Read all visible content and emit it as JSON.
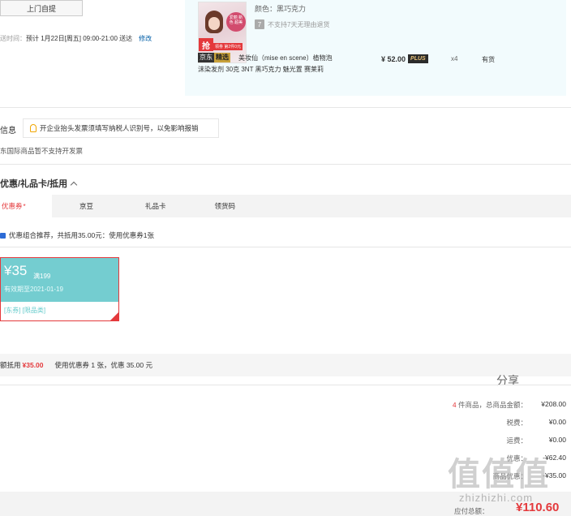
{
  "delivery": {
    "pickup_button": "上门自提",
    "time_label": "送时间：",
    "time_value": "预计 1月22日[周五] 09:00-21:00 送达",
    "modify": "修改"
  },
  "product": {
    "color": "颜色：黑巧克力",
    "no_return": "不支持7天无理由退货",
    "return_icon": "7",
    "tag_jd": "京东",
    "tag_jx": "精选",
    "thumb_grab": "抢",
    "thumb_caption": "领劵 第2件0元",
    "thumb_badge": "爱丽 新色 超美",
    "name_line1": "美妆仙（mise en scene）植物泡",
    "name_line2": "沫染发剂 30克 3NT 黑巧克力 魅光置 赛莱莉",
    "price": "¥ 52.00",
    "plus": "PLUS",
    "qty": "x4",
    "stock": "有货"
  },
  "invoice": {
    "label": "信息",
    "tip": "开企业抬头发票须填写纳税人识别号，以免影响报销",
    "note": "东国际商品暂不支持开发票"
  },
  "discount": {
    "title": "优惠/礼品卡/抵用",
    "tabs": [
      {
        "label": "优惠券",
        "mark": "*"
      },
      {
        "label": "京豆"
      },
      {
        "label": "礼品卡"
      },
      {
        "label": "领货码"
      }
    ],
    "combo_text": "优惠组合推荐，共抵用35.00元：使用优惠券1张",
    "coupon": {
      "amount": "¥35",
      "threshold": "满199",
      "valid": "有效期至2021-01-19",
      "tags": "[东券] [限品类]"
    },
    "summary_label": "额抵用",
    "summary_amount": "¥35.00",
    "summary_text": "使用优惠券 1 张，优惠 35.00 元"
  },
  "share": "分享",
  "totals": {
    "count": "4",
    "count_suffix": " 件商品，总商品金额：",
    "goods_amount": "¥208.00",
    "tax_label": "税费：",
    "tax": "¥0.00",
    "shipping_label": "运费：",
    "shipping": "¥0.00",
    "coupon_label": "优惠：",
    "coupon": "-¥35.00",
    "other_label": "商品优惠：",
    "other": "-¥62.40",
    "payable_label": "应付总额：",
    "payable": "¥110.60"
  },
  "watermark": {
    "big": "值值值",
    "url": "zhizhizhi.com"
  },
  "colors": {
    "accent": "#e4393c",
    "coupon_bg": "#74cdd0",
    "link": "#005ea7"
  }
}
